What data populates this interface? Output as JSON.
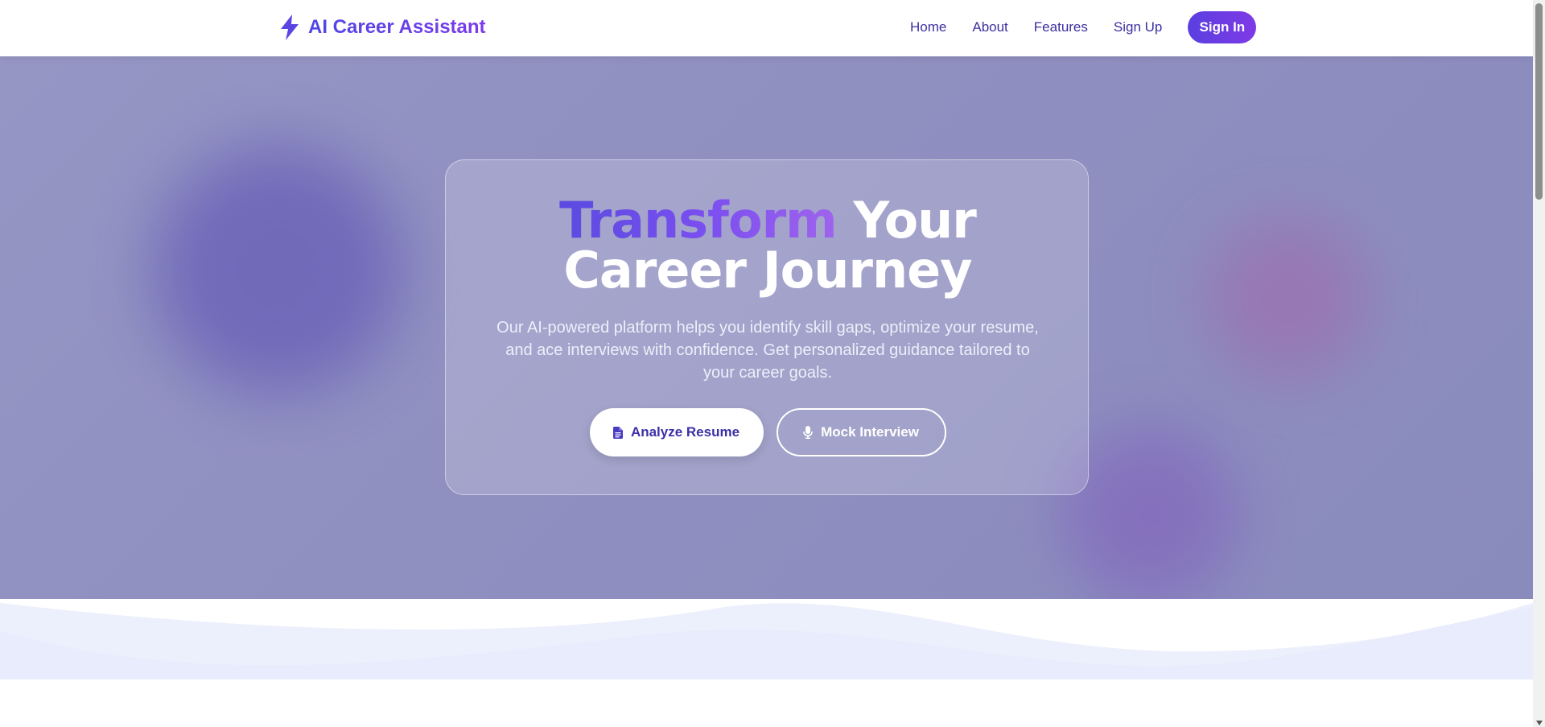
{
  "brand": {
    "name": "AI Career Assistant",
    "icon": "bolt-icon"
  },
  "nav": {
    "items": [
      "Home",
      "About",
      "Features",
      "Sign Up"
    ],
    "signin_label": "Sign In"
  },
  "hero": {
    "headline_accent": "Transform",
    "headline_line1_rest": " Your",
    "headline_line2": "Career Journey",
    "subtitle": "Our AI-powered platform helps you identify skill gaps, optimize your resume, and ace interviews with confidence. Get personalized guidance tailored to your career goals.",
    "primary_button": {
      "label": "Analyze Resume",
      "icon": "document-icon"
    },
    "secondary_button": {
      "label": "Mock Interview",
      "icon": "microphone-icon"
    }
  },
  "colors": {
    "brand_primary": "#4f46e5",
    "brand_secondary": "#7c3aed",
    "hero_background": "#8f8fc0"
  }
}
